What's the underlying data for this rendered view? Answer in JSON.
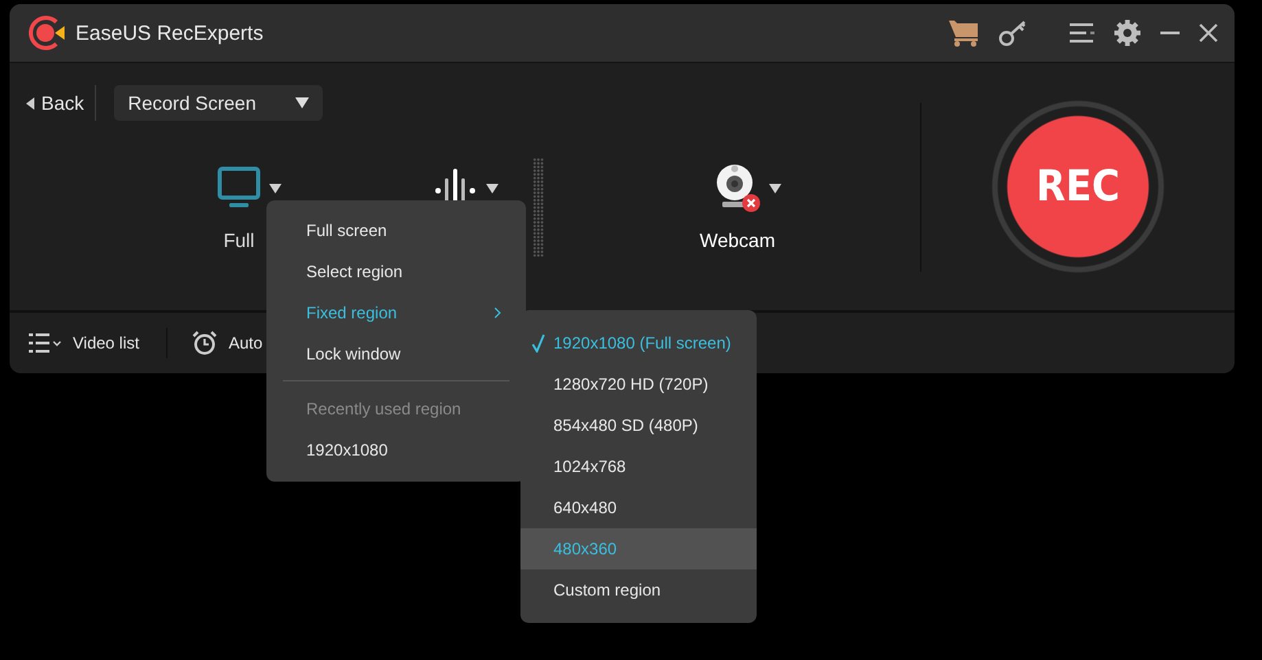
{
  "window": {
    "title": "EaseUS RecExperts"
  },
  "toolbar": {
    "back": "Back",
    "mode_dropdown": "Record Screen"
  },
  "sources": [
    {
      "kind": "screen",
      "label": "Full"
    },
    {
      "kind": "audio"
    },
    {
      "kind": "webcam",
      "label": "Webcam",
      "disabled": true
    }
  ],
  "rec_button": "REC",
  "bottom_bar": {
    "video_list": "Video list",
    "auto": "Auto"
  },
  "region_menu": {
    "items": [
      {
        "kind": "item",
        "label": "Full screen",
        "selected": false,
        "has_submenu": false
      },
      {
        "kind": "item",
        "label": "Select region",
        "selected": false,
        "has_submenu": false
      },
      {
        "kind": "item",
        "label": "Fixed region",
        "selected": true,
        "has_submenu": true
      },
      {
        "kind": "item",
        "label": "Lock window",
        "selected": false,
        "has_submenu": false
      },
      {
        "kind": "separator"
      },
      {
        "kind": "header",
        "label": "Recently used region"
      },
      {
        "kind": "item",
        "label": "1920x1080",
        "selected": false,
        "has_submenu": false
      }
    ]
  },
  "fixed_region_submenu": {
    "items": [
      {
        "label": "1920x1080 (Full screen)",
        "checked": true,
        "selected": false
      },
      {
        "label": "1280x720 HD (720P)",
        "checked": false,
        "selected": false
      },
      {
        "label": "854x480 SD (480P)",
        "checked": false,
        "selected": false
      },
      {
        "label": "1024x768",
        "checked": false,
        "selected": false
      },
      {
        "label": "640x480",
        "checked": false,
        "selected": false
      },
      {
        "label": "480x360",
        "checked": false,
        "selected": true
      },
      {
        "label": "Custom region",
        "checked": false,
        "selected": false
      }
    ]
  }
}
